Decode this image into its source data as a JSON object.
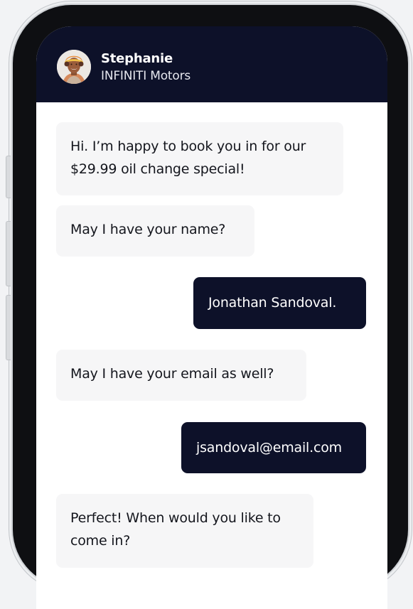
{
  "chat": {
    "agent_name": "Stephanie",
    "agent_company": "INFINITI Motors",
    "messages": [
      {
        "from": "agent",
        "text": "Hi. I’m happy to book you in for our $29.99 oil change special!"
      },
      {
        "from": "agent",
        "text": "May I have your name?"
      },
      {
        "from": "user",
        "text": "Jonathan Sandoval."
      },
      {
        "from": "agent",
        "text": "May I have your email as well?"
      },
      {
        "from": "user",
        "text": "jsandoval@email.com"
      },
      {
        "from": "agent",
        "text": "Perfect! When would you like to come in?"
      }
    ]
  },
  "colors": {
    "header_bg": "#0d1129",
    "user_bubble": "#0d1129",
    "agent_bubble": "#f6f6f7",
    "page_bg": "#f2f3f5"
  }
}
